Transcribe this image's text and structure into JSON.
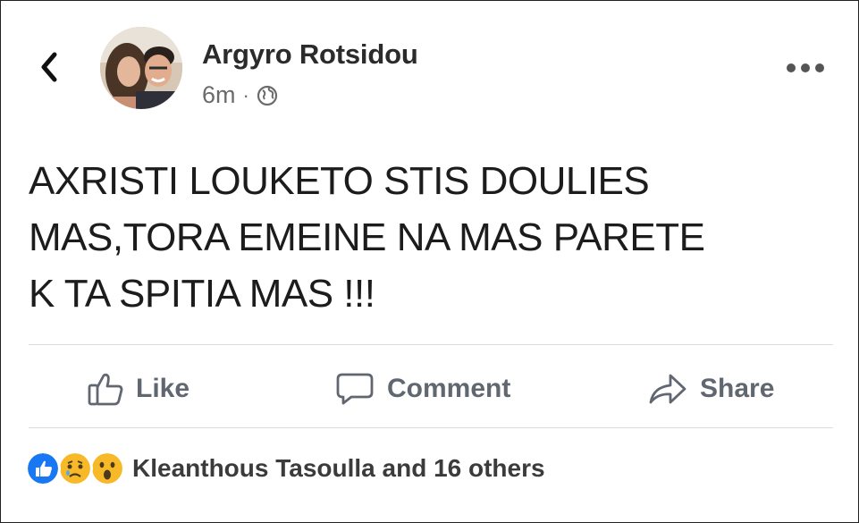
{
  "post": {
    "author_name": "Argyro Rotsidou",
    "time": "6m",
    "separator": "·",
    "body": "AXRISTI LOUKETO STIS DOULIES\nMAS,TORA EMEINE NA MAS PARETE\nK TA SPITIA MAS !!!"
  },
  "actions": {
    "like_label": "Like",
    "comment_label": "Comment",
    "share_label": "Share"
  },
  "reactions": {
    "summary": "Kleanthous Tasoulla and 16 others",
    "icons": [
      "like-reaction-icon",
      "sad-reaction-icon",
      "wow-reaction-icon"
    ]
  },
  "colors": {
    "like_blue": "#1877f2",
    "reaction_yellow": "#f7b928",
    "action_gray": "#606770"
  }
}
